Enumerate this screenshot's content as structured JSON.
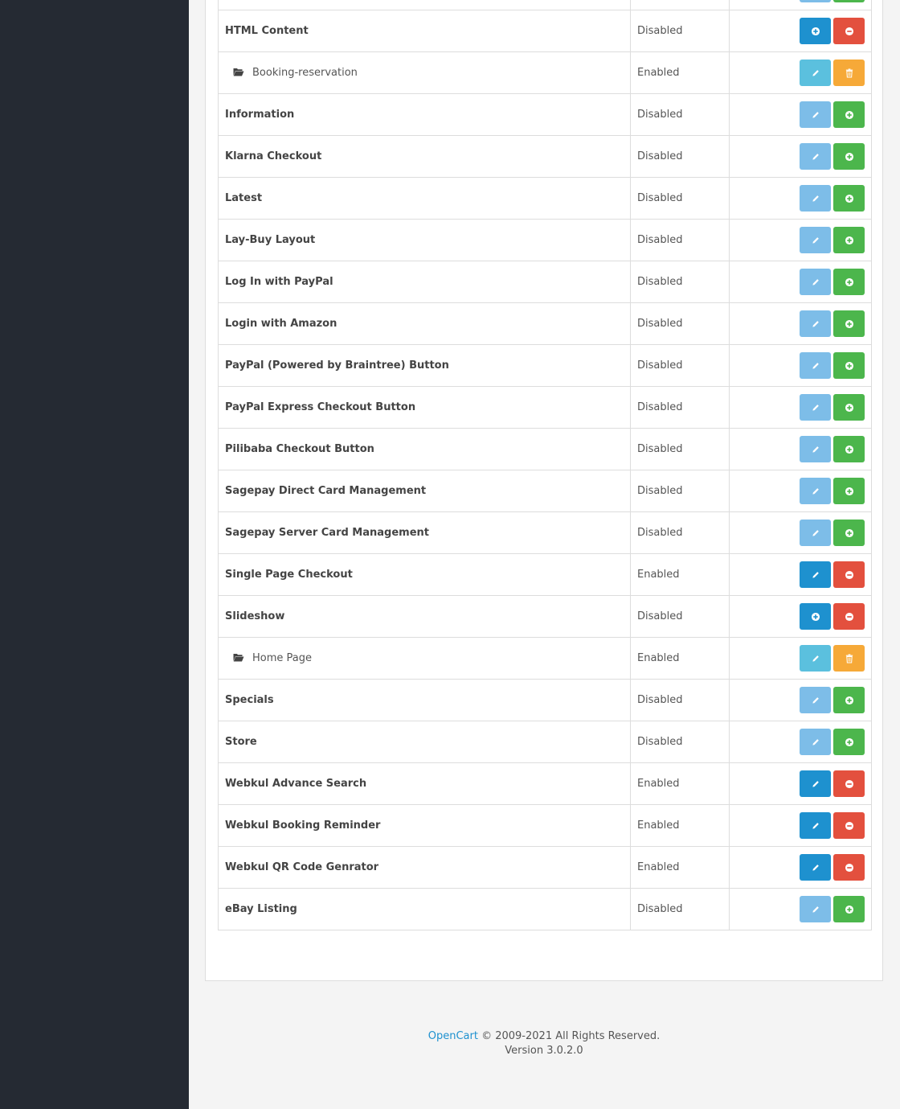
{
  "rows": [
    {
      "name": "",
      "status": "",
      "type": "module",
      "edit": "disabled",
      "action": "add"
    },
    {
      "name": "HTML Content",
      "status": "Disabled",
      "type": "module",
      "edit": "install",
      "action": "remove"
    },
    {
      "name": "Booking-reservation",
      "status": "Enabled",
      "type": "child",
      "edit": "child",
      "action": "delete"
    },
    {
      "name": "Information",
      "status": "Disabled",
      "type": "module",
      "edit": "disabled",
      "action": "add"
    },
    {
      "name": "Klarna Checkout",
      "status": "Disabled",
      "type": "module",
      "edit": "disabled",
      "action": "add"
    },
    {
      "name": "Latest",
      "status": "Disabled",
      "type": "module",
      "edit": "disabled",
      "action": "add"
    },
    {
      "name": "Lay-Buy Layout",
      "status": "Disabled",
      "type": "module",
      "edit": "disabled",
      "action": "add"
    },
    {
      "name": "Log In with PayPal",
      "status": "Disabled",
      "type": "module",
      "edit": "disabled",
      "action": "add"
    },
    {
      "name": "Login with Amazon",
      "status": "Disabled",
      "type": "module",
      "edit": "disabled",
      "action": "add"
    },
    {
      "name": "PayPal (Powered by Braintree) Button",
      "status": "Disabled",
      "type": "module",
      "edit": "disabled",
      "action": "add"
    },
    {
      "name": "PayPal Express Checkout Button",
      "status": "Disabled",
      "type": "module",
      "edit": "disabled",
      "action": "add"
    },
    {
      "name": "Pilibaba Checkout Button",
      "status": "Disabled",
      "type": "module",
      "edit": "disabled",
      "action": "add"
    },
    {
      "name": "Sagepay Direct Card Management",
      "status": "Disabled",
      "type": "module",
      "edit": "disabled",
      "action": "add"
    },
    {
      "name": "Sagepay Server Card Management",
      "status": "Disabled",
      "type": "module",
      "edit": "disabled",
      "action": "add"
    },
    {
      "name": "Single Page Checkout",
      "status": "Enabled",
      "type": "module",
      "edit": "active",
      "action": "remove"
    },
    {
      "name": "Slideshow",
      "status": "Disabled",
      "type": "module",
      "edit": "install",
      "action": "remove"
    },
    {
      "name": "Home Page",
      "status": "Enabled",
      "type": "child",
      "edit": "child",
      "action": "delete"
    },
    {
      "name": "Specials",
      "status": "Disabled",
      "type": "module",
      "edit": "disabled",
      "action": "add"
    },
    {
      "name": "Store",
      "status": "Disabled",
      "type": "module",
      "edit": "disabled",
      "action": "add"
    },
    {
      "name": "Webkul Advance Search",
      "status": "Enabled",
      "type": "module",
      "edit": "active",
      "action": "remove"
    },
    {
      "name": "Webkul Booking Reminder",
      "status": "Enabled",
      "type": "module",
      "edit": "active",
      "action": "remove"
    },
    {
      "name": "Webkul QR Code Genrator",
      "status": "Enabled",
      "type": "module",
      "edit": "active",
      "action": "remove"
    },
    {
      "name": "eBay Listing",
      "status": "Disabled",
      "type": "module",
      "edit": "disabled",
      "action": "add"
    }
  ],
  "footer": {
    "brand_link": "OpenCart",
    "copyright": "© 2009-2021 All Rights Reserved.",
    "version": "Version 3.0.2.0"
  },
  "colors": {
    "sidebar": "#252a33",
    "primary": "#1e91cf",
    "edit_disabled": "#7dbde8",
    "info": "#5bc0de",
    "success": "#4cb64c",
    "danger": "#e3503e",
    "warning": "#f6a938"
  },
  "icons": {
    "edit": "pencil-icon",
    "add": "plus-circle-icon",
    "remove": "minus-circle-icon",
    "delete": "trash-icon",
    "install": "plus-circle-icon",
    "folder": "folder-open-icon"
  }
}
